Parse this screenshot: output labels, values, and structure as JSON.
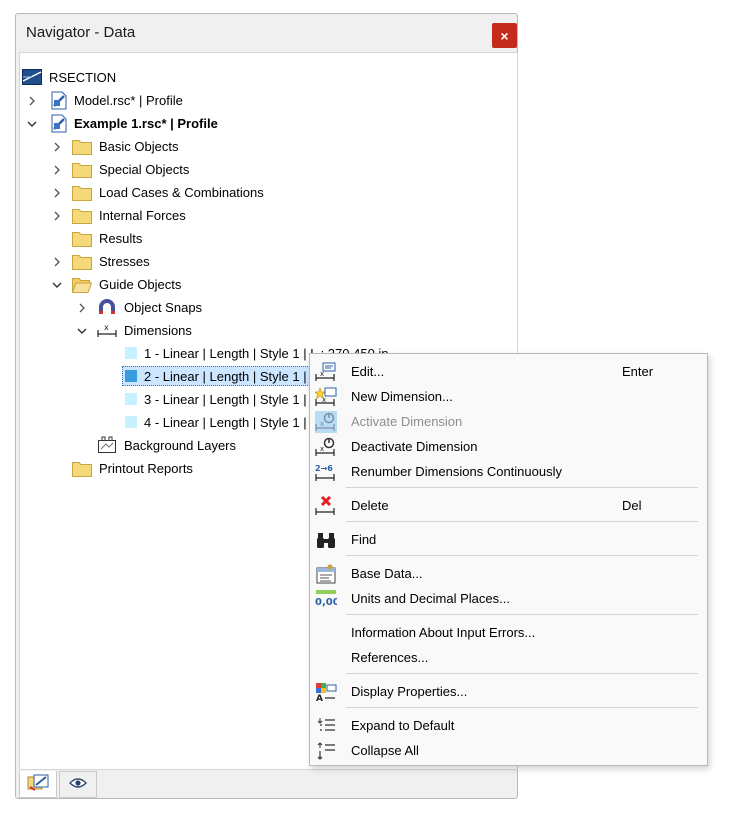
{
  "window": {
    "title": "Navigator - Data",
    "close_glyph": "×"
  },
  "tree": {
    "root": "RSECTION",
    "model": "Model.rsc* | Profile",
    "example": "Example 1.rsc* | Profile",
    "basic_objects": "Basic Objects",
    "special_objects": "Special Objects",
    "load_cases": "Load Cases & Combinations",
    "internal_forces": "Internal Forces",
    "results": "Results",
    "stresses": "Stresses",
    "guide_objects": "Guide Objects",
    "object_snaps": "Object Snaps",
    "dimensions": "Dimensions",
    "dim1": "1 - Linear | Length | Style 1 | L : 270.450 in",
    "dim2": "2 - Linear | Length | Style 1 | L",
    "dim3": "3 - Linear | Length | Style 1 | L",
    "dim4": "4 - Linear | Length | Style 1 | L",
    "background_layers": "Background Layers",
    "printout_reports": "Printout Reports"
  },
  "context_menu": {
    "edit": {
      "label": "Edit...",
      "shortcut": "Enter"
    },
    "new_dimension": "New Dimension...",
    "activate_dimension": "Activate Dimension",
    "deactivate_dimension": "Deactivate Dimension",
    "renumber": "Renumber Dimensions Continuously",
    "delete": {
      "label": "Delete",
      "shortcut": "Del"
    },
    "find": "Find",
    "base_data": "Base Data...",
    "units": "Units and Decimal Places...",
    "info_errors": "Information About Input Errors...",
    "references": "References...",
    "display_properties": "Display Properties...",
    "expand_default": "Expand to Default",
    "collapse_all": "Collapse All"
  },
  "icon_text": {
    "renumber_icon": "2→6",
    "units_icon": "0,00"
  },
  "colors": {
    "accent_selection": "#cce6ff",
    "close_button": "#c42b1c",
    "folder": "#f5d87a",
    "dimension_square": "#c9f0ff",
    "delete_red": "#e01f1f"
  }
}
